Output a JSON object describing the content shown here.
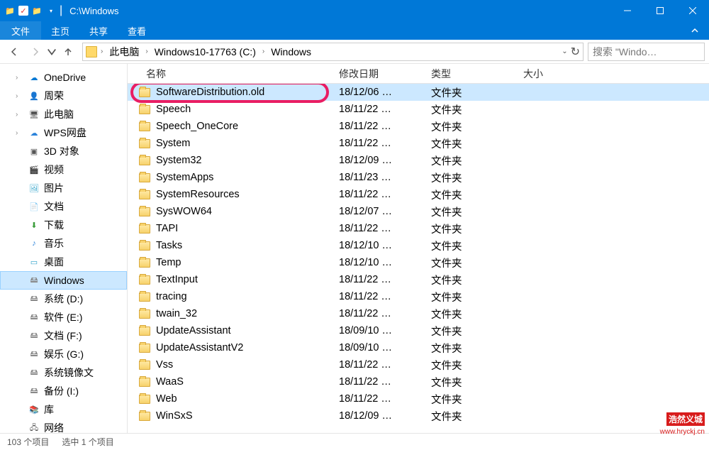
{
  "titlebar": {
    "title": "C:\\Windows"
  },
  "menubar": {
    "file": "文件",
    "home": "主页",
    "share": "共享",
    "view": "查看"
  },
  "breadcrumb": {
    "segments": [
      "此电脑",
      "Windows10-17763 (C:)",
      "Windows"
    ]
  },
  "search": {
    "placeholder": "搜索 \"Windo…"
  },
  "sidebar": {
    "items": [
      {
        "label": "OneDrive",
        "iconClass": "ico-onedrive",
        "glyph": "☁"
      },
      {
        "label": "周荣",
        "iconClass": "ico-user",
        "glyph": "👤"
      },
      {
        "label": "此电脑",
        "iconClass": "ico-pc",
        "glyph": "🖥"
      },
      {
        "label": "WPS网盘",
        "iconClass": "ico-wps",
        "glyph": "☁"
      },
      {
        "label": "3D 对象",
        "iconClass": "ico-3d",
        "glyph": "▣"
      },
      {
        "label": "视频",
        "iconClass": "ico-video",
        "glyph": "🎬"
      },
      {
        "label": "图片",
        "iconClass": "ico-pic",
        "glyph": "🖼"
      },
      {
        "label": "文档",
        "iconClass": "ico-doc",
        "glyph": "📄"
      },
      {
        "label": "下载",
        "iconClass": "ico-down",
        "glyph": "⬇"
      },
      {
        "label": "音乐",
        "iconClass": "ico-music",
        "glyph": "♪"
      },
      {
        "label": "桌面",
        "iconClass": "ico-desktop",
        "glyph": "▭"
      },
      {
        "label": "Windows",
        "iconClass": "ico-disk",
        "glyph": "🖴",
        "selected": true
      },
      {
        "label": "系统 (D:)",
        "iconClass": "ico-disk",
        "glyph": "🖴"
      },
      {
        "label": "软件 (E:)",
        "iconClass": "ico-disk",
        "glyph": "🖴"
      },
      {
        "label": "文档 (F:)",
        "iconClass": "ico-disk",
        "glyph": "🖴"
      },
      {
        "label": "娱乐 (G:)",
        "iconClass": "ico-disk",
        "glyph": "🖴"
      },
      {
        "label": "系统镜像文",
        "iconClass": "ico-disk",
        "glyph": "🖴"
      },
      {
        "label": "备份 (I:)",
        "iconClass": "ico-disk",
        "glyph": "🖴"
      },
      {
        "label": "库",
        "iconClass": "ico-folder",
        "glyph": "📚"
      },
      {
        "label": "网络",
        "iconClass": "ico-pc",
        "glyph": "🖧"
      }
    ]
  },
  "columns": {
    "name": "名称",
    "date": "修改日期",
    "type": "类型",
    "size": "大小"
  },
  "files": [
    {
      "name": "SoftwareDistribution.old",
      "date": "18/12/06 …",
      "type": "文件夹",
      "selected": true,
      "highlighted": true
    },
    {
      "name": "Speech",
      "date": "18/11/22 …",
      "type": "文件夹"
    },
    {
      "name": "Speech_OneCore",
      "date": "18/11/22 …",
      "type": "文件夹"
    },
    {
      "name": "System",
      "date": "18/11/22 …",
      "type": "文件夹"
    },
    {
      "name": "System32",
      "date": "18/12/09 …",
      "type": "文件夹"
    },
    {
      "name": "SystemApps",
      "date": "18/11/23 …",
      "type": "文件夹"
    },
    {
      "name": "SystemResources",
      "date": "18/11/22 …",
      "type": "文件夹"
    },
    {
      "name": "SysWOW64",
      "date": "18/12/07 …",
      "type": "文件夹"
    },
    {
      "name": "TAPI",
      "date": "18/11/22 …",
      "type": "文件夹"
    },
    {
      "name": "Tasks",
      "date": "18/12/10 …",
      "type": "文件夹"
    },
    {
      "name": "Temp",
      "date": "18/12/10 …",
      "type": "文件夹"
    },
    {
      "name": "TextInput",
      "date": "18/11/22 …",
      "type": "文件夹"
    },
    {
      "name": "tracing",
      "date": "18/11/22 …",
      "type": "文件夹"
    },
    {
      "name": "twain_32",
      "date": "18/11/22 …",
      "type": "文件夹"
    },
    {
      "name": "UpdateAssistant",
      "date": "18/09/10 …",
      "type": "文件夹"
    },
    {
      "name": "UpdateAssistantV2",
      "date": "18/09/10 …",
      "type": "文件夹"
    },
    {
      "name": "Vss",
      "date": "18/11/22 …",
      "type": "文件夹"
    },
    {
      "name": "WaaS",
      "date": "18/11/22 …",
      "type": "文件夹"
    },
    {
      "name": "Web",
      "date": "18/11/22 …",
      "type": "文件夹"
    },
    {
      "name": "WinSxS",
      "date": "18/12/09 …",
      "type": "文件夹"
    }
  ],
  "statusbar": {
    "count": "103 个项目",
    "selected": "选中 1 个项目"
  },
  "watermark": {
    "main": "浩然义城",
    "sub": "www.hryckj.cn"
  }
}
